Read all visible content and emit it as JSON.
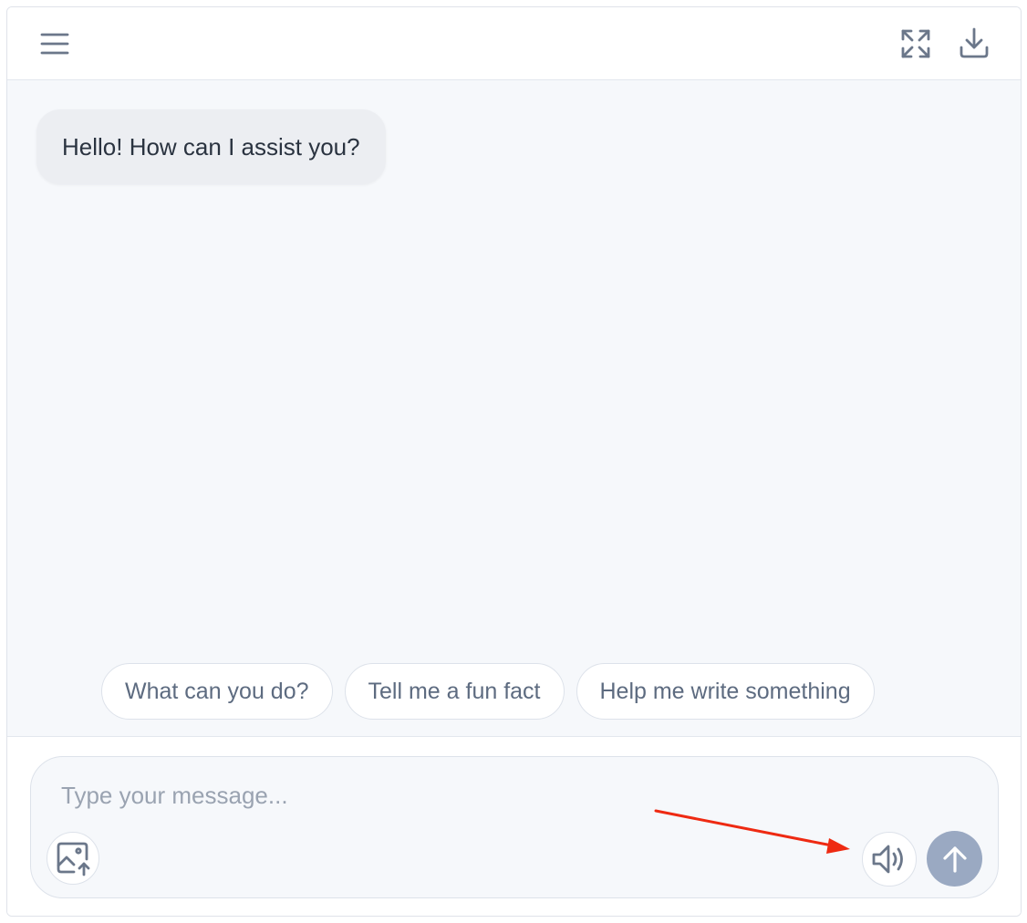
{
  "header": {
    "menu_icon": "hamburger-menu-icon",
    "expand_icon": "expand-arrows-icon",
    "download_icon": "download-icon"
  },
  "chat": {
    "messages": [
      {
        "role": "assistant",
        "text": "Hello! How can I assist you?"
      }
    ],
    "suggestions": [
      "What can you do?",
      "Tell me a fun fact",
      "Help me write something"
    ]
  },
  "composer": {
    "placeholder": "Type your message...",
    "value": "",
    "upload_icon": "image-upload-icon",
    "speaker_icon": "speaker-icon",
    "send_icon": "arrow-up-icon"
  },
  "colors": {
    "icon": "#6b778a",
    "send_button": "#9aa9c2",
    "annotation_arrow": "#ee2a12"
  }
}
